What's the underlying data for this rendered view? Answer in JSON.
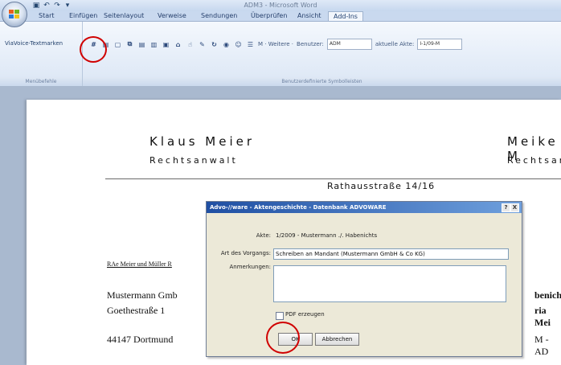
{
  "window": {
    "title": "ADM3 - Microsoft Word"
  },
  "ribbon": {
    "tabs": [
      "Start",
      "Einfügen",
      "Seitenlayout",
      "Verweise",
      "Sendungen",
      "Überprüfen",
      "Ansicht",
      "Add-Ins"
    ],
    "active_tab": "Add-Ins",
    "menu_group_button": "ViaVoice-Textmarken",
    "menu_group_label": "Menübefehle",
    "custom_group_label": "Benutzerdefinierte Symbolleisten",
    "toolbar": {
      "weitere_label": "M · Weitere ·",
      "benutzer_label": "Benutzer:",
      "benutzer_value": "ADM",
      "akte_label": "aktuelle Akte:",
      "akte_value": "I-1/09-M"
    }
  },
  "document": {
    "left_name": "Klaus Meier",
    "left_title": "Rechtsanwalt",
    "right_name": "Meike M",
    "right_title": "Rechtsan",
    "address_top": "Rathausstraße 14/16",
    "sender_line": "RAe Meier und Müller   R",
    "recipient_lines": [
      "Mustermann Gmb",
      "Goethestraße 1",
      "44147 Dortmund"
    ],
    "right_lines": [
      "benicht",
      "ria Mei",
      "M - AD"
    ]
  },
  "dialog": {
    "title": "Advo-//ware - Aktengeschichte - Datenbank ADVOWARE",
    "akte_label": "Akte:",
    "akte_value": "1/2009 - Mustermann ./. Habenichts",
    "vorgang_label": "Art des Vorgangs:",
    "vorgang_value": "Schreiben an Mandant (Mustermann GmbH & Co KG)",
    "anmerkungen_label": "Anmerkungen:",
    "pdf_label": "PDF erzeugen",
    "ok_label": "OK",
    "cancel_label": "Abbrechen",
    "help_label": "?",
    "close_label": "X"
  },
  "colors": {
    "annotation_red": "#d00000",
    "title_blue": "#1f4fa3",
    "ribbon_bg": "#dbe6f5"
  }
}
